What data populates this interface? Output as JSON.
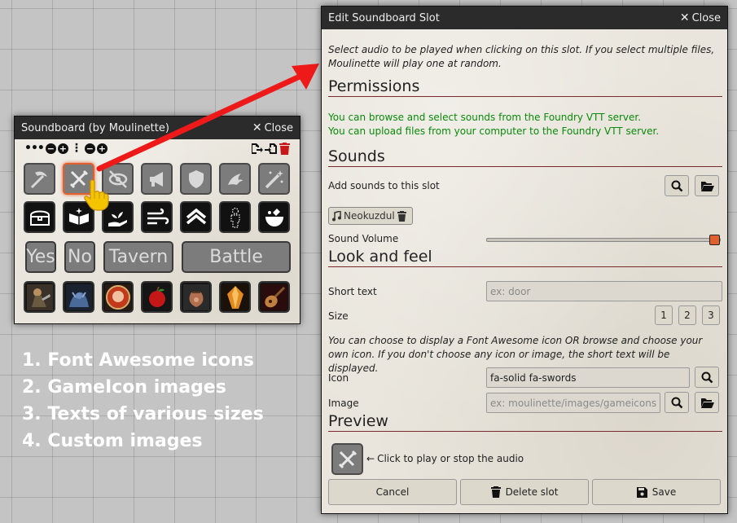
{
  "soundboard": {
    "title": "Soundboard (by Moulinette)",
    "close_label": "Close",
    "text_slots": [
      "Yes",
      "No",
      "Tavern",
      "Battle"
    ]
  },
  "dialog": {
    "title": "Edit Soundboard Slot",
    "close_label": "Close",
    "intro": "Select audio to be played when clicking on this slot. If you select multiple files, Moulinette will play one at random.",
    "permissions_heading": "Permissions",
    "perm_browse": "You can browse and select sounds from the Foundry VTT server.",
    "perm_upload": "You can upload files from your computer to the Foundry VTT server.",
    "sounds_heading": "Sounds",
    "add_sounds_label": "Add sounds to this slot",
    "sound_chip": "Neokuzdul",
    "volume_label": "Sound Volume",
    "volume": 1.0,
    "look_heading": "Look and feel",
    "short_text_label": "Short text",
    "short_text_placeholder": "ex: door",
    "size_label": "Size",
    "sizes": [
      "1",
      "2",
      "3"
    ],
    "icon_note": "You can choose to display a Font Awesome icon OR browse and choose your own icon. If you don't choose any icon or image, the short text will be displayed.",
    "icon_label": "Icon",
    "icon_value": "fa-solid fa-swords",
    "image_label": "Image",
    "image_placeholder": "ex: moulinette/images/gameicons/",
    "preview_heading": "Preview",
    "preview_hint": "Click to play or stop the audio",
    "cancel_label": "Cancel",
    "delete_label": "Delete slot",
    "save_label": "Save"
  },
  "caption": [
    "1. Font Awesome icons",
    "2. GameIcon images",
    "3. Texts of various sizes",
    "4. Custom images"
  ],
  "colors": {
    "accent": "#e06030",
    "arrow": "#ee1a1a",
    "permission_text": "#0a8a0a",
    "header_bg": "#2b2b2b"
  }
}
